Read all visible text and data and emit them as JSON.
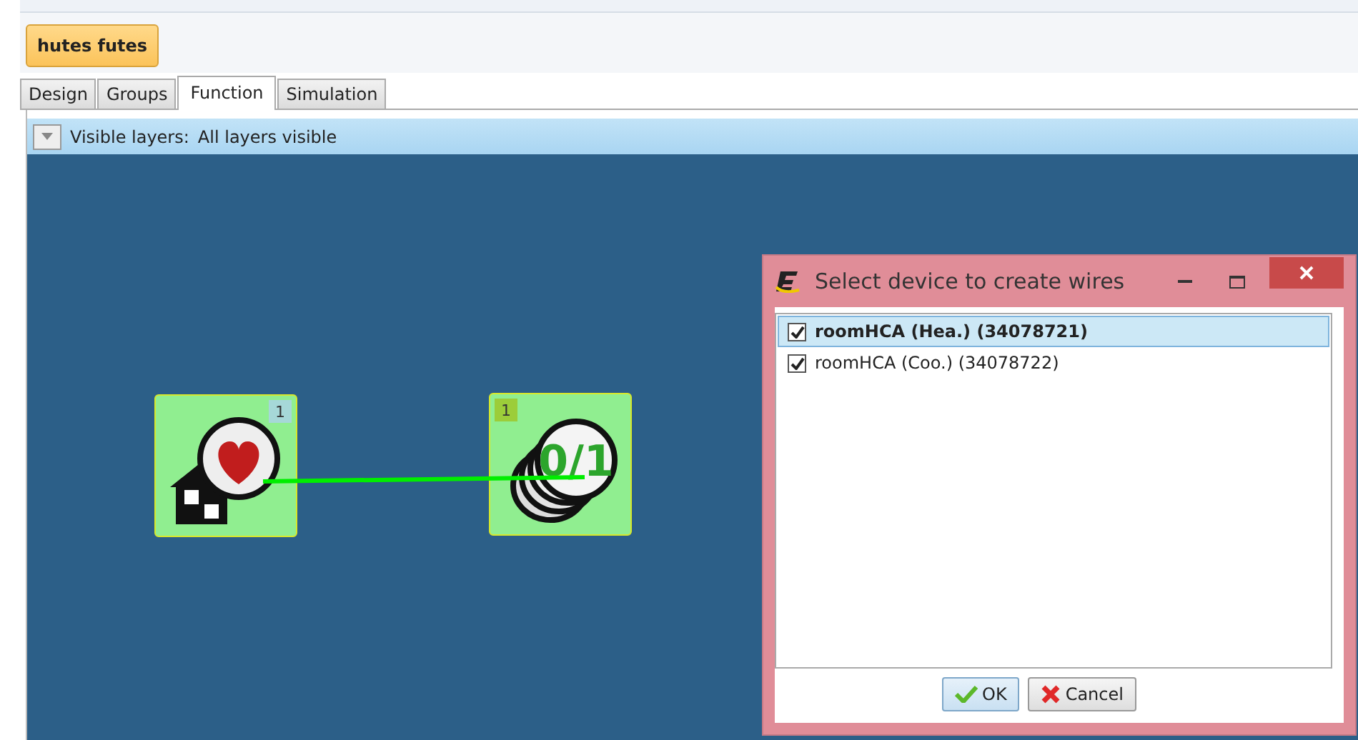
{
  "project_button": "hutes futes",
  "tabs": [
    {
      "label": "Design",
      "selected": false
    },
    {
      "label": "Groups",
      "selected": false
    },
    {
      "label": "Function",
      "selected": true
    },
    {
      "label": "Simulation",
      "selected": false
    }
  ],
  "layers": {
    "label": "Visible layers:",
    "value": "All layers visible"
  },
  "nodes": [
    {
      "kind": "room",
      "badge": "1"
    },
    {
      "kind": "switch",
      "badge": "1",
      "symbol": "0/1"
    }
  ],
  "dialog": {
    "title": "Select device to create wires",
    "items": [
      {
        "label": "roomHCA (Hea.) (34078721)",
        "checked": true,
        "selected": true
      },
      {
        "label": "roomHCA (Coo.) (34078722)",
        "checked": true,
        "selected": false
      }
    ],
    "buttons": [
      {
        "kind": "ok",
        "label": "OK"
      },
      {
        "kind": "cancel",
        "label": "Cancel"
      }
    ]
  }
}
